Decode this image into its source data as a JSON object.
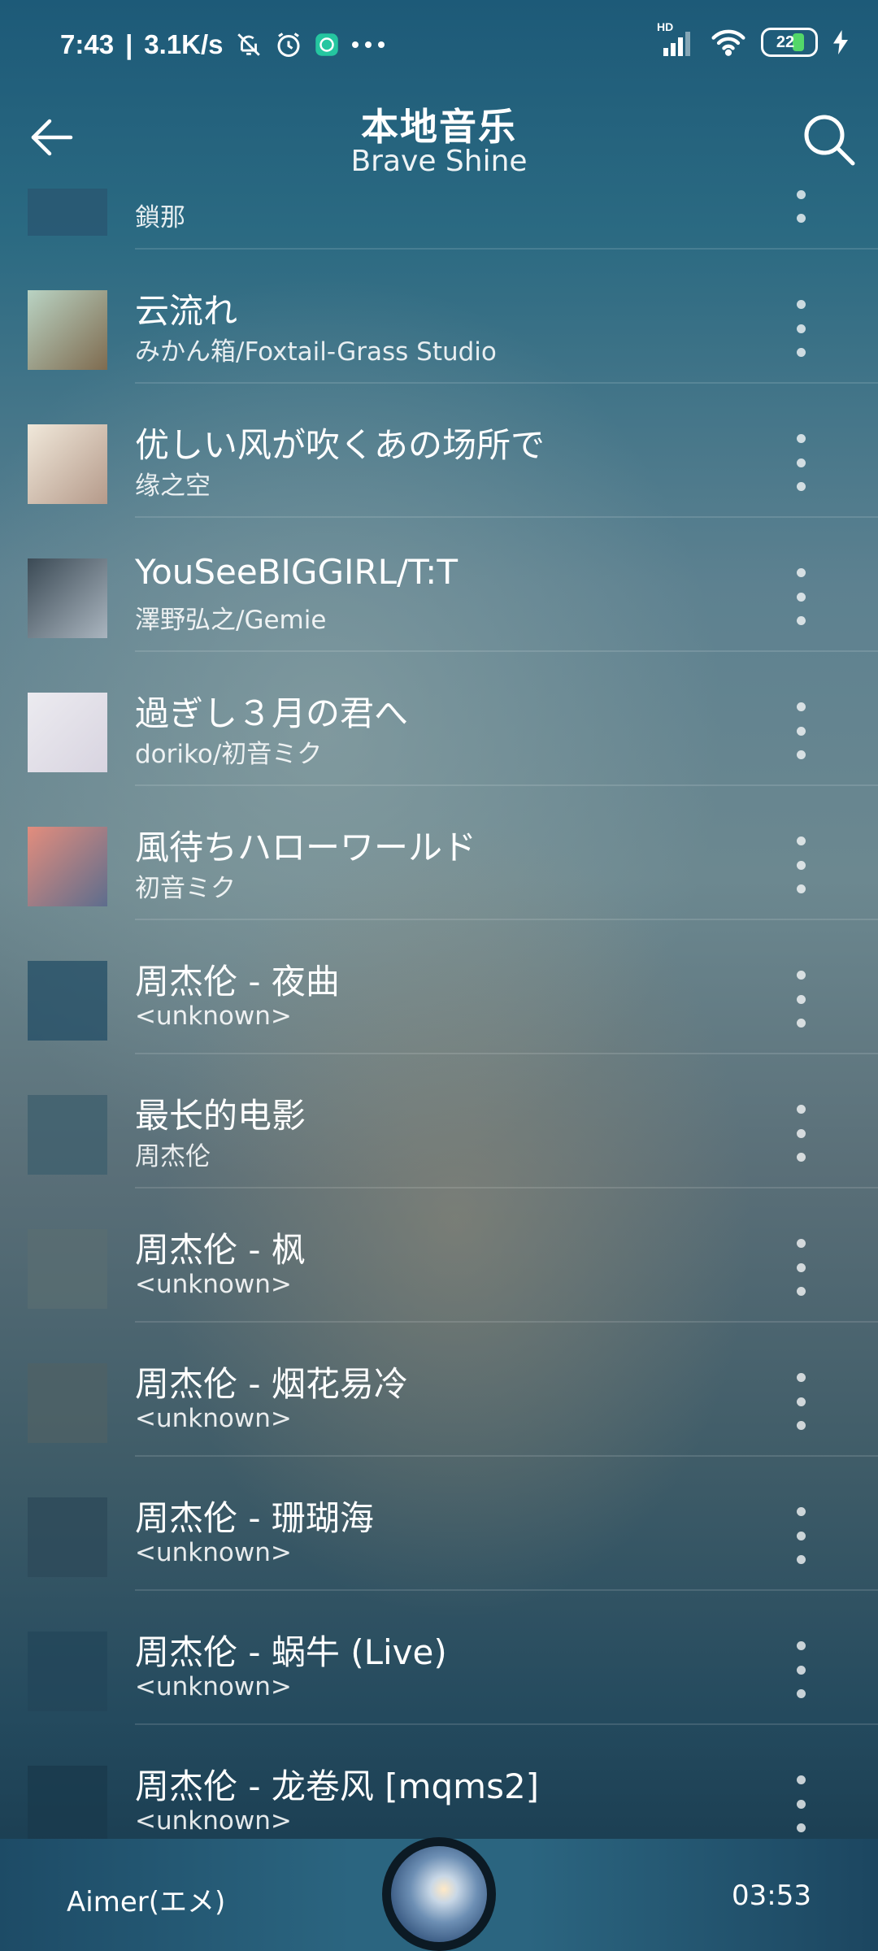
{
  "status_bar": {
    "time": "7:43",
    "separator": "|",
    "net_speed": "3.1K/s",
    "signal_tag": "HD",
    "battery_level": "22"
  },
  "header": {
    "title": "本地音乐",
    "subtitle": "Brave Shine"
  },
  "songs": [
    {
      "title": "",
      "artist": "鎖那",
      "thumb": [
        "#2a5670",
        "#2a5670"
      ]
    },
    {
      "title": "云流れ",
      "artist": "みかん箱/Foxtail-Grass Studio",
      "thumb": [
        "#b9d3c3",
        "#7f6b4f"
      ]
    },
    {
      "title": "优しい风が吹くあの场所で",
      "artist": "缘之空",
      "thumb": [
        "#f0e8da",
        "#b59a8a"
      ]
    },
    {
      "title": "YouSeeBIGGIRL/T:T",
      "artist": "澤野弘之/Gemie",
      "thumb": [
        "#3b4a55",
        "#aab5bf"
      ]
    },
    {
      "title": "過ぎし３月の君へ",
      "artist": "doriko/初音ミク",
      "thumb": [
        "#ecebf0",
        "#d8d4e0"
      ]
    },
    {
      "title": "風待ちハローワールド",
      "artist": "初音ミク",
      "thumb": [
        "#e38d7d",
        "#5d6d8d"
      ]
    },
    {
      "title": "周杰伦 - 夜曲",
      "artist": "<unknown>",
      "thumb": [
        "#234e66",
        "#234e66"
      ]
    },
    {
      "title": "最长的电影",
      "artist": "周杰伦",
      "thumb": [
        "#3d5f6e",
        "#3d5f6e"
      ]
    },
    {
      "title": "周杰伦 - 枫",
      "artist": "<unknown>",
      "thumb": [
        "#5a6d72",
        "#5a6d72"
      ]
    },
    {
      "title": "周杰伦 - 烟花易冷",
      "artist": "<unknown>",
      "thumb": [
        "#4f6166",
        "#4f6166"
      ]
    },
    {
      "title": "周杰伦 - 珊瑚海",
      "artist": "<unknown>",
      "thumb": [
        "#2d4a5a",
        "#2d4a5a"
      ]
    },
    {
      "title": "周杰伦 - 蜗牛 (Live)",
      "artist": "<unknown>",
      "thumb": [
        "#23465a",
        "#23465a"
      ]
    },
    {
      "title": "周杰伦 - 龙卷风 [mqms2]",
      "artist": "<unknown>",
      "thumb": [
        "#1a3a4c",
        "#1a3a4c"
      ]
    }
  ],
  "player": {
    "artist": "Aimer(エメ)",
    "duration": "03:53"
  },
  "colors": {
    "battery_fill": "#53d769",
    "player_bar": "#2b6580"
  }
}
